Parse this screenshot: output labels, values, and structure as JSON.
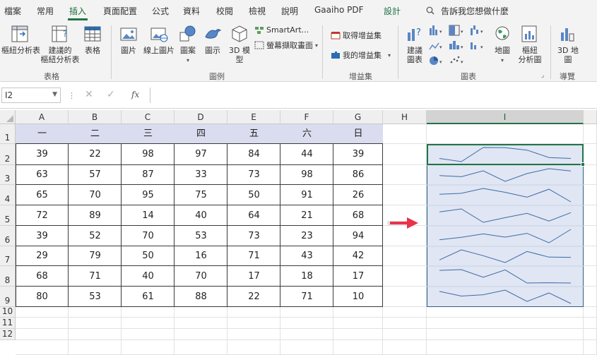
{
  "tabs": [
    {
      "label": "檔案",
      "active": false
    },
    {
      "label": "常用",
      "active": false
    },
    {
      "label": "插入",
      "active": true
    },
    {
      "label": "頁面配置",
      "active": false
    },
    {
      "label": "公式",
      "active": false
    },
    {
      "label": "資料",
      "active": false
    },
    {
      "label": "校閱",
      "active": false
    },
    {
      "label": "檢視",
      "active": false
    },
    {
      "label": "說明",
      "active": false
    },
    {
      "label": "Gaaiho PDF",
      "active": false
    },
    {
      "label": "設計",
      "active": false
    }
  ],
  "tell_me": "告訴我您想做什麼",
  "ribbon": {
    "pivot_table": "樞紐分析表",
    "recommended_pivot": [
      "建議的",
      "樞紐分析表"
    ],
    "table": "表格",
    "group_tables": "表格",
    "pictures": "圖片",
    "online_pictures": "線上圖片",
    "shapes": "圖案",
    "icons": "圖示",
    "model_3d": [
      "3D 模",
      "型"
    ],
    "smartart": "SmartArt...",
    "screenshot": "螢幕擷取畫面",
    "group_illustrations": "圖例",
    "get_addins": "取得增益集",
    "my_addins": "我的增益集",
    "group_addins": "增益集",
    "recommended_charts": [
      "建議",
      "圖表"
    ],
    "maps": "地圖",
    "pivot_chart": [
      "樞紐",
      "分析圖"
    ],
    "group_charts": "圖表",
    "map_3d": [
      "3D 地",
      "圖"
    ],
    "group_tours": "導覽"
  },
  "name_box": "I2",
  "fx_label": "fx",
  "formula_value": "",
  "columns": [
    "A",
    "B",
    "C",
    "D",
    "E",
    "F",
    "G",
    "H",
    "I"
  ],
  "selected_column": "I",
  "rows": [
    "1",
    "2",
    "3",
    "4",
    "5",
    "6",
    "7",
    "8",
    "9",
    "10",
    "11",
    "12"
  ],
  "table": {
    "headers": [
      "一",
      "二",
      "三",
      "四",
      "五",
      "六",
      "日"
    ],
    "rows": [
      [
        39,
        22,
        98,
        97,
        84,
        44,
        39
      ],
      [
        63,
        57,
        87,
        33,
        73,
        98,
        86
      ],
      [
        65,
        70,
        95,
        75,
        50,
        91,
        26
      ],
      [
        72,
        89,
        14,
        40,
        64,
        21,
        68
      ],
      [
        39,
        52,
        70,
        53,
        73,
        23,
        94
      ],
      [
        29,
        79,
        50,
        16,
        71,
        43,
        42
      ],
      [
        68,
        71,
        40,
        70,
        17,
        18,
        17
      ],
      [
        80,
        53,
        61,
        88,
        22,
        71,
        10
      ]
    ]
  },
  "colors": {
    "accent_green": "#217346",
    "header_fill": "#dadcef",
    "sparkline_fill": "#e0e6f3",
    "sparkline_stroke": "#3d6aa8",
    "arrow": "#e8334a"
  },
  "icons": [
    "search-icon",
    "pivot-table-icon",
    "table-icon",
    "picture-icon",
    "shapes-icon",
    "cube-icon",
    "chart-icon",
    "globe-icon",
    "arrow-right-icon"
  ]
}
